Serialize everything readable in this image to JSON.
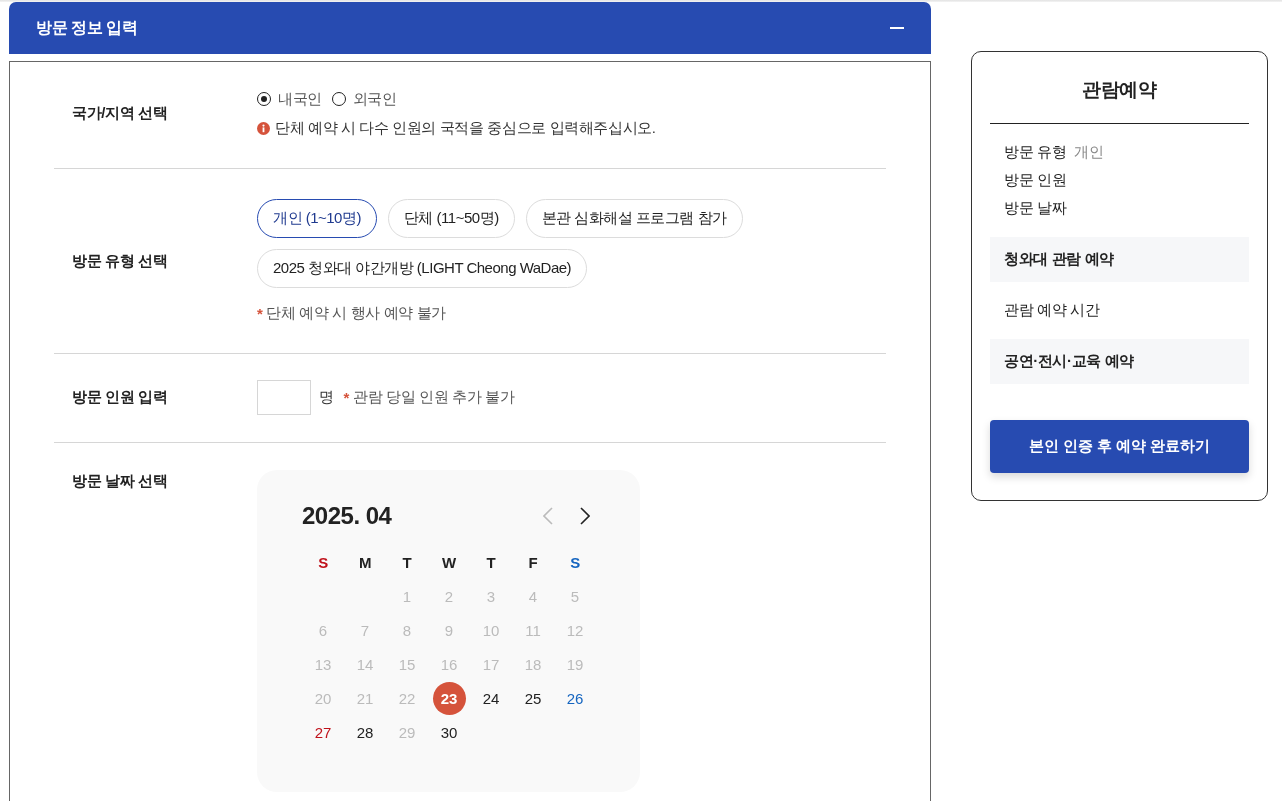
{
  "section": {
    "title": "방문 정보 입력",
    "expanded": true,
    "nationality_row": {
      "label": "국가/지역 선택",
      "options": [
        {
          "label": "내국인",
          "selected": true
        },
        {
          "label": "외국인",
          "selected": false
        }
      ],
      "notice": "단체 예약 시 다수 인원의 국적을 중심으로 입력해주십시오."
    },
    "visit_type_row": {
      "label": "방문 유형 선택",
      "options": [
        {
          "label": "개인 (1~10명)",
          "selected": true
        },
        {
          "label": "단체 (11~50명)",
          "selected": false
        },
        {
          "label": "본관 심화해설 프로그램 참가",
          "selected": false
        },
        {
          "label": "2025 청와대 야간개방 (LIGHT Cheong WaDae)",
          "selected": false
        }
      ],
      "note": {
        "mark": "*",
        "text": "단체 예약 시 행사 예약 불가"
      }
    },
    "count_row": {
      "label": "방문 인원 입력",
      "unit": "명",
      "note": {
        "mark": "*",
        "text": "관람 당일 인원 추가 불가"
      }
    },
    "date_row": {
      "label": "방문 날짜 선택",
      "calendar": {
        "title": "2025. 04",
        "prev_disabled": true,
        "next_disabled": false,
        "weekdays": [
          {
            "label": "S",
            "color": "#c0121b"
          },
          {
            "label": "M",
            "color": "#222222"
          },
          {
            "label": "T",
            "color": "#222222"
          },
          {
            "label": "W",
            "color": "#222222"
          },
          {
            "label": "T",
            "color": "#222222"
          },
          {
            "label": "F",
            "color": "#222222"
          },
          {
            "label": "S",
            "color": "#1565c0"
          }
        ],
        "weeks": [
          [
            {
              "day": "1",
              "disabled": true,
              "selected": false
            },
            {
              "day": "2",
              "disabled": true,
              "selected": false
            },
            {
              "day": "3",
              "disabled": true,
              "selected": false
            },
            {
              "day": "4",
              "disabled": true,
              "selected": false
            },
            {
              "day": "5",
              "disabled": true,
              "selected": false
            }
          ],
          [
            {
              "day": "6",
              "disabled": true,
              "selected": false
            },
            {
              "day": "7",
              "disabled": true,
              "selected": false
            },
            {
              "day": "8",
              "disabled": true,
              "selected": false
            },
            {
              "day": "9",
              "disabled": true,
              "selected": false
            },
            {
              "day": "10",
              "disabled": true,
              "selected": false
            },
            {
              "day": "11",
              "disabled": true,
              "selected": false
            },
            {
              "day": "12",
              "disabled": true,
              "selected": false
            }
          ],
          [
            {
              "day": "13",
              "disabled": true,
              "selected": false
            },
            {
              "day": "14",
              "disabled": true,
              "selected": false
            },
            {
              "day": "15",
              "disabled": true,
              "selected": false
            },
            {
              "day": "16",
              "disabled": true,
              "selected": false
            },
            {
              "day": "17",
              "disabled": true,
              "selected": false
            },
            {
              "day": "18",
              "disabled": true,
              "selected": false
            },
            {
              "day": "19",
              "disabled": true,
              "selected": false
            }
          ],
          [
            {
              "day": "20",
              "disabled": true,
              "selected": false
            },
            {
              "day": "21",
              "disabled": true,
              "selected": false
            },
            {
              "day": "22",
              "disabled": true,
              "selected": false
            },
            {
              "day": "23",
              "disabled": false,
              "selected": true
            },
            {
              "day": "24",
              "disabled": false,
              "selected": false
            },
            {
              "day": "25",
              "disabled": false,
              "selected": false
            },
            {
              "day": "26",
              "disabled": false,
              "selected": false
            }
          ],
          [
            {
              "day": "27",
              "disabled": false,
              "selected": false
            },
            {
              "day": "28",
              "disabled": false,
              "selected": false
            },
            {
              "day": "29",
              "disabled": true,
              "selected": false
            },
            {
              "day": "30",
              "disabled": false,
              "selected": false
            }
          ]
        ]
      }
    }
  },
  "summary": {
    "title": "관람예약",
    "items": [
      {
        "label": "방문 유형",
        "value": "개인"
      },
      {
        "label": "방문 인원"
      },
      {
        "label": "방문 날짜"
      }
    ],
    "sections": [
      {
        "label": "청와대 관람 예약",
        "kind": "group"
      },
      {
        "label": "관람 예약 시간",
        "kind": "item"
      },
      {
        "label": "공연·전시·교육 예약",
        "kind": "group"
      }
    ],
    "button": "본인 인증 후 예약 완료하기"
  }
}
